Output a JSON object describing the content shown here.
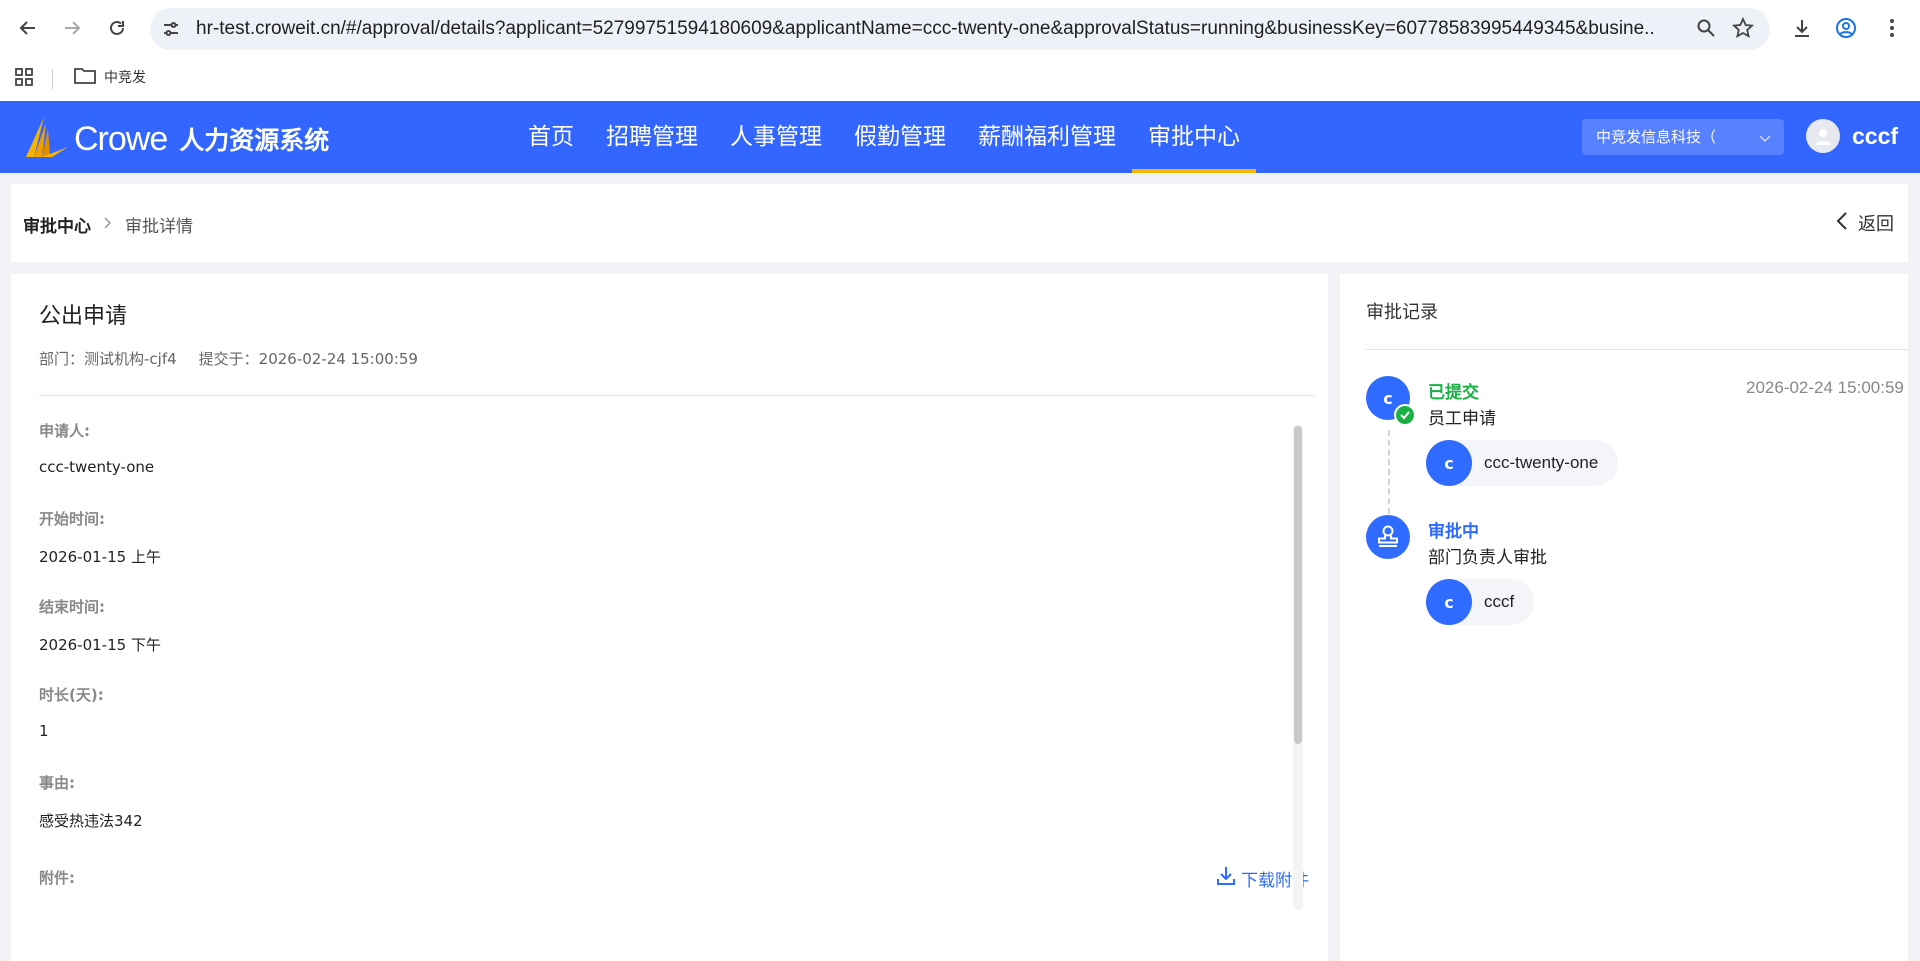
{
  "browser": {
    "url": "hr-test.croweit.cn/#/approval/details?applicant=52799751594180609&applicantName=ccc-twenty-one&approvalStatus=running&businessKey=60778583995449345&busine...",
    "bookmark_folder": "中竞发"
  },
  "header": {
    "brand": "Crowe",
    "system_name": "人力资源系统",
    "nav": [
      {
        "label": "首页"
      },
      {
        "label": "招聘管理"
      },
      {
        "label": "人事管理"
      },
      {
        "label": "假勤管理"
      },
      {
        "label": "薪酬福利管理"
      },
      {
        "label": "审批中心",
        "active": true
      }
    ],
    "company": "中竞发信息科技（",
    "user_name": "cccf",
    "accent_color": "#f7b500",
    "bar_color": "#3366ff"
  },
  "breadcrumb": {
    "root": "审批中心",
    "current": "审批详情",
    "back_label": "返回"
  },
  "form": {
    "title": "公出申请",
    "department": "部门：测试机构-cjf4",
    "submitted": "提交于：2026-02-24 15:00:59",
    "fields": [
      {
        "label": "申请人:",
        "value": "ccc-twenty-one"
      },
      {
        "label": "开始时间:",
        "value": "2026-01-15 上午"
      },
      {
        "label": "结束时间:",
        "value": "2026-01-15 下午"
      },
      {
        "label": "时长(天):",
        "value": "1"
      },
      {
        "label": "事由:",
        "value": "感受热违法342"
      }
    ],
    "attachment_label": "附件:",
    "download_label": "下载附件"
  },
  "records": {
    "title": "审批记录",
    "steps": [
      {
        "avatar": "c",
        "status": "已提交",
        "status_color": "#19b046",
        "desc": "员工申请",
        "time": "2026-02-24 15:00:59",
        "person_avatar": "c",
        "person": "ccc-twenty-one"
      },
      {
        "status": "审批中",
        "status_color": "#2f6bff",
        "desc": "部门负责人审批",
        "person_avatar": "c",
        "person": "cccf"
      }
    ]
  }
}
